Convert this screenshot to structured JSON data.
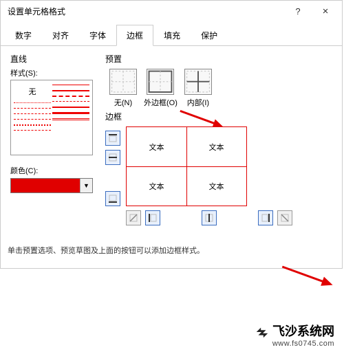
{
  "titlebar": {
    "title": "设置单元格格式",
    "help": "?",
    "close": "×"
  },
  "tabs": [
    "数字",
    "对齐",
    "字体",
    "边框",
    "填充",
    "保护"
  ],
  "active_tab": 3,
  "left": {
    "line_label": "直线",
    "style_label": "样式(S):",
    "none_text": "无",
    "color_label": "颜色(C):",
    "color_value": "#e00000"
  },
  "right": {
    "preset_label": "预置",
    "presets": [
      {
        "caption": "无(N)"
      },
      {
        "caption": "外边框(O)"
      },
      {
        "caption": "内部(I)"
      }
    ],
    "border_label": "边框",
    "sample_text": "文本"
  },
  "hint": "单击预置选项、预览草图及上面的按钮可以添加边框样式。",
  "watermark": {
    "brand": "飞沙系统网",
    "url": "www.fs0745.com"
  }
}
